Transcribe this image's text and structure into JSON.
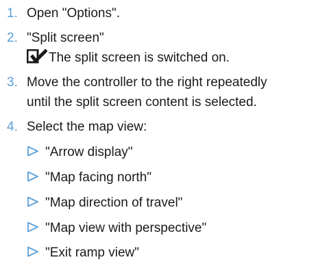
{
  "steps": [
    {
      "number": "1.",
      "text": "Open \"Options\"."
    },
    {
      "number": "2.",
      "text": "\"Split screen\"",
      "result": "The split screen is switched on."
    },
    {
      "number": "3.",
      "line1": "Move the controller to the right repeatedly",
      "line2": "until the split screen content is selected."
    },
    {
      "number": "4.",
      "text": "Select the map view:"
    }
  ],
  "options": [
    "\"Arrow display\"",
    "\"Map facing north\"",
    "\"Map direction of travel\"",
    "\"Map view with perspective\"",
    "\"Exit ramp view\""
  ],
  "colors": {
    "number": "#5aa0d8",
    "text": "#1a1a1a",
    "icon": "#1a1a1a"
  },
  "icons": {
    "result": "checkbox-check-icon",
    "option": "triangle-right-icon"
  }
}
